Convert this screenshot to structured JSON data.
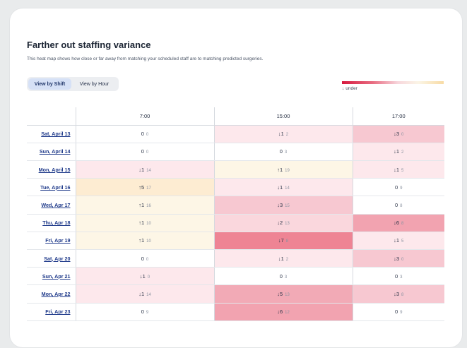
{
  "header": {
    "title": "Farther out staffing variance",
    "subtitle": "This heat map shows how close or far away from matching your scheduled staff are to matching predicted surgeries."
  },
  "toggle": {
    "view_by_shift": "View by Shift",
    "view_by_hour": "View by Hour",
    "active": "View by Shift"
  },
  "legend": {
    "under_arrow": "↓",
    "under_label": "under"
  },
  "colors": {
    "under_strong": "#f09aa6",
    "under_mid": "#f6c1ca",
    "under_light": "#fde6ea",
    "over_light": "#fdf4e4",
    "neutral": "#ffffff",
    "link": "#1f3a8a"
  },
  "table": {
    "columns": [
      "7:00",
      "15:00",
      "17:00"
    ],
    "rows": [
      {
        "day": "Sat, April 13",
        "cells": [
          {
            "arrow": "",
            "value": "0",
            "sub": "0",
            "level": "neutral"
          },
          {
            "arrow": "↓",
            "value": "1",
            "sub": "2",
            "level": "under_light"
          },
          {
            "arrow": "↓",
            "value": "3",
            "sub": "0",
            "level": "under_mid"
          }
        ]
      },
      {
        "day": "Sun, April 14",
        "cells": [
          {
            "arrow": "",
            "value": "0",
            "sub": "0",
            "level": "neutral"
          },
          {
            "arrow": "",
            "value": "0",
            "sub": "3",
            "level": "neutral"
          },
          {
            "arrow": "↓",
            "value": "1",
            "sub": "2",
            "level": "under_light"
          }
        ]
      },
      {
        "day": "Mon, April 15",
        "cells": [
          {
            "arrow": "↓",
            "value": "1",
            "sub": "14",
            "level": "under_light"
          },
          {
            "arrow": "↑",
            "value": "1",
            "sub": "19",
            "level": "over_light"
          },
          {
            "arrow": "↓",
            "value": "1",
            "sub": "5",
            "level": "under_light"
          }
        ]
      },
      {
        "day": "Tue, April 16",
        "cells": [
          {
            "arrow": "↑",
            "value": "5",
            "sub": "17",
            "level": "over_mid"
          },
          {
            "arrow": "↓",
            "value": "1",
            "sub": "14",
            "level": "under_light"
          },
          {
            "arrow": "",
            "value": "0",
            "sub": "9",
            "level": "neutral"
          }
        ]
      },
      {
        "day": "Wed, Apr 17",
        "cells": [
          {
            "arrow": "↑",
            "value": "1",
            "sub": "16",
            "level": "over_light"
          },
          {
            "arrow": "↓",
            "value": "3",
            "sub": "15",
            "level": "under_mid"
          },
          {
            "arrow": "",
            "value": "0",
            "sub": "8",
            "level": "neutral"
          }
        ]
      },
      {
        "day": "Thu, Apr 18",
        "cells": [
          {
            "arrow": "↑",
            "value": "1",
            "sub": "10",
            "level": "over_light"
          },
          {
            "arrow": "↓",
            "value": "2",
            "sub": "13",
            "level": "under_light2"
          },
          {
            "arrow": "↓",
            "value": "6",
            "sub": "8",
            "level": "under_strong"
          }
        ]
      },
      {
        "day": "Fri, Apr 19",
        "cells": [
          {
            "arrow": "↑",
            "value": "1",
            "sub": "10",
            "level": "over_light"
          },
          {
            "arrow": "↓",
            "value": "7",
            "sub": "8",
            "level": "under_strongest"
          },
          {
            "arrow": "↓",
            "value": "1",
            "sub": "5",
            "level": "under_light"
          }
        ]
      },
      {
        "day": "Sat, Apr 20",
        "cells": [
          {
            "arrow": "",
            "value": "0",
            "sub": "0",
            "level": "neutral"
          },
          {
            "arrow": "↓",
            "value": "1",
            "sub": "2",
            "level": "under_light"
          },
          {
            "arrow": "↓",
            "value": "3",
            "sub": "0",
            "level": "under_mid"
          }
        ]
      },
      {
        "day": "Sun, Apr 21",
        "cells": [
          {
            "arrow": "↓",
            "value": "1",
            "sub": "0",
            "level": "under_light"
          },
          {
            "arrow": "",
            "value": "0",
            "sub": "3",
            "level": "neutral"
          },
          {
            "arrow": "",
            "value": "0",
            "sub": "3",
            "level": "neutral"
          }
        ]
      },
      {
        "day": "Mon, Apr 22",
        "cells": [
          {
            "arrow": "↓",
            "value": "1",
            "sub": "14",
            "level": "under_light"
          },
          {
            "arrow": "↓",
            "value": "5",
            "sub": "13",
            "level": "under_strong2"
          },
          {
            "arrow": "↓",
            "value": "3",
            "sub": "8",
            "level": "under_mid"
          }
        ]
      },
      {
        "day": "Fri, Apr 23",
        "cells": [
          {
            "arrow": "",
            "value": "0",
            "sub": "9",
            "level": "neutral"
          },
          {
            "arrow": "↓",
            "value": "6",
            "sub": "12",
            "level": "under_strong"
          },
          {
            "arrow": "",
            "value": "0",
            "sub": "9",
            "level": "neutral"
          }
        ]
      }
    ]
  }
}
